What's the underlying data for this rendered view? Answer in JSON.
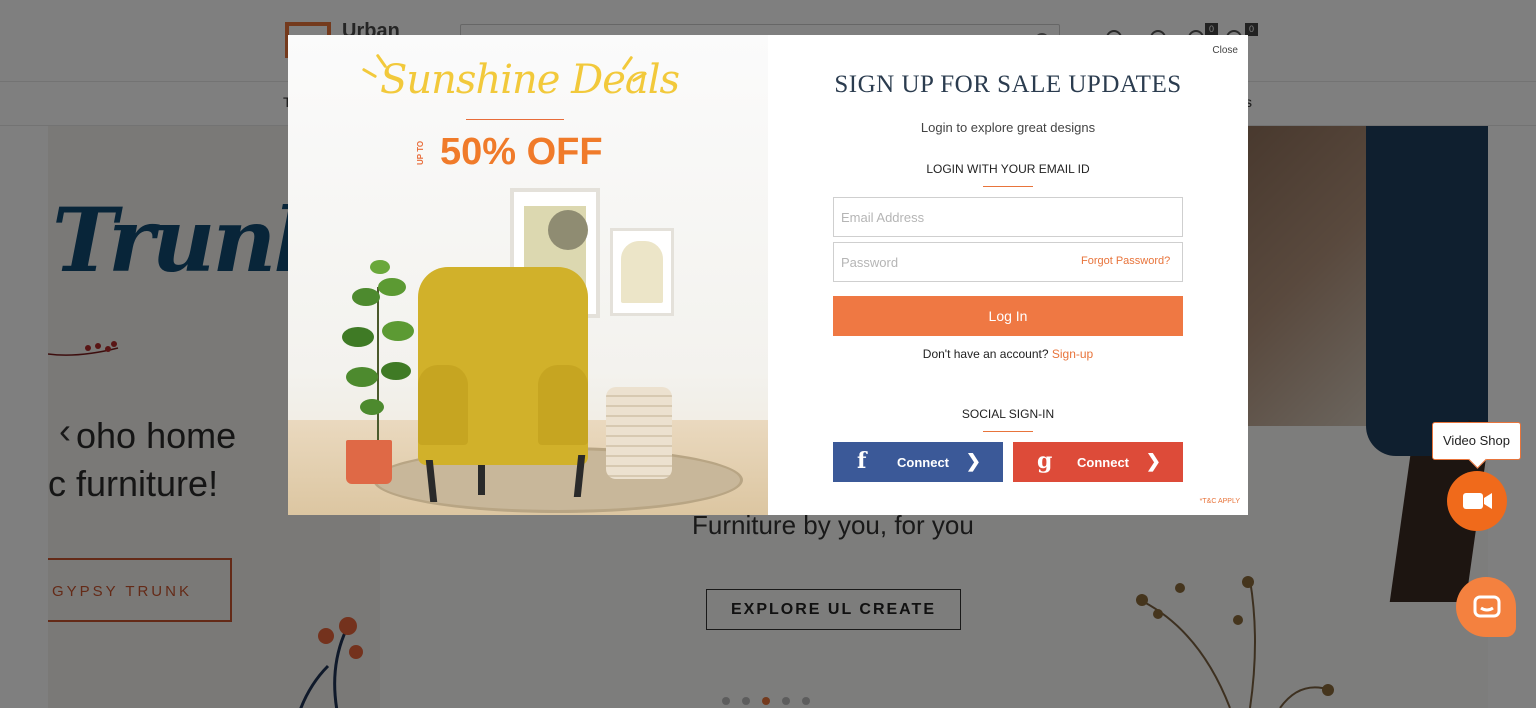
{
  "background": {
    "header": {
      "logo_text": "Urban",
      "cart_count": "0",
      "wishlist_count": "0"
    },
    "nav": {
      "left_fragment": "T",
      "right_fragment": "s"
    },
    "banner_left": {
      "headline": "Trunk",
      "boho_line1": "oho home",
      "boho_line2": "c furniture!",
      "cta": "GYPSY TRUNK"
    },
    "banner_center": {
      "tagline": "Furniture by you, for you",
      "cta": "EXPLORE UL CREATE"
    },
    "carousel": {
      "prev_arrow": "‹",
      "next_arrow": "›",
      "active_slide": 3,
      "slide_count": 5
    }
  },
  "widgets": {
    "video_shop_label": "Video Shop"
  },
  "modal": {
    "close_label": "Close",
    "promo": {
      "headline": "Sunshine Deals",
      "up_to": "UP TO",
      "discount": "50% OFF"
    },
    "title": "SIGN UP FOR SALE UPDATES",
    "subtitle": "Login to explore great designs",
    "login_header": "LOGIN WITH YOUR EMAIL ID",
    "email_placeholder": "Email Address",
    "password_placeholder": "Password",
    "forgot_password": "Forgot Password?",
    "login_button": "Log In",
    "no_account_text": "Don't have an account?",
    "signup_link": "Sign-up",
    "social_header": "SOCIAL SIGN-IN",
    "facebook": {
      "glyph": "f",
      "label": "Connect"
    },
    "google": {
      "glyph": "g",
      "label": "Connect"
    },
    "tnc": "*T&C APPLY"
  },
  "colors": {
    "accent": "#ef7843",
    "facebook": "#3b5998",
    "google": "#dd4b39",
    "title": "#2b3c4f",
    "overlay": "rgba(0,0,0,0.5)"
  }
}
